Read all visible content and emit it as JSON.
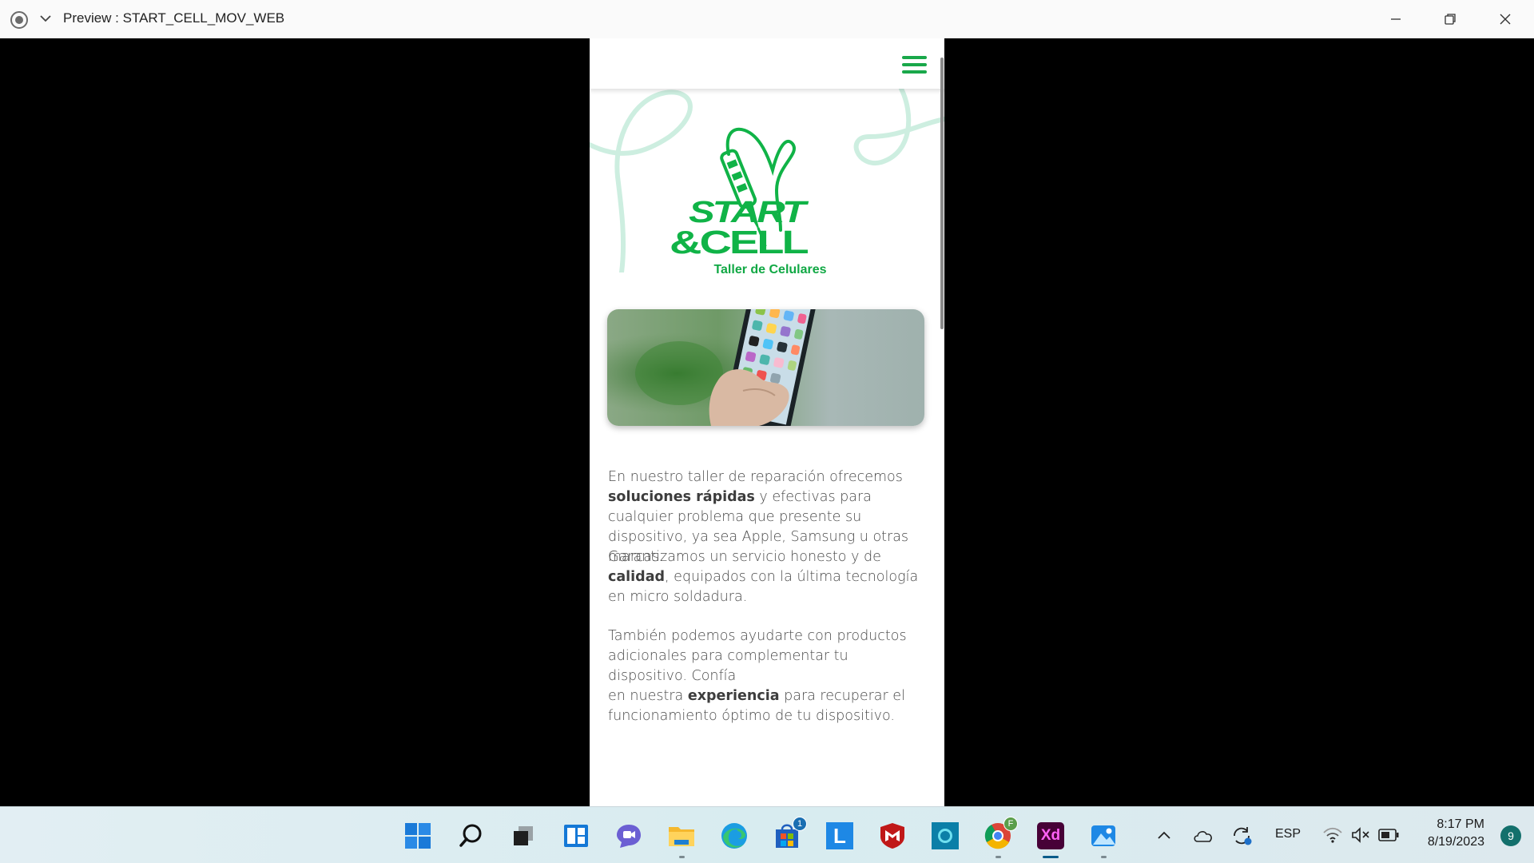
{
  "window": {
    "title": "Preview : START_CELL_MOV_WEB"
  },
  "phone": {
    "logo": {
      "line1": "START",
      "line2": "&CELL",
      "subtitle": "Taller de Celulares"
    },
    "paragraphs": [
      {
        "parts": [
          {
            "text": "En nuestro taller de reparación ofrecemos ",
            "bold": false
          },
          {
            "text": "soluciones rápidas",
            "bold": true
          },
          {
            "text": " y efectivas para cualquier problema que presente su dispositivo, ya sea Apple, Samsung u otras marcas.",
            "bold": false
          }
        ]
      },
      {
        "parts": [
          {
            "text": "Garantizamos un servicio honesto y de ",
            "bold": false
          },
          {
            "text": "calidad",
            "bold": true
          },
          {
            "text": ", equipados con la última tecnología en micro soldadura.",
            "bold": false
          }
        ]
      },
      {
        "parts": [
          {
            "text": "También podemos ayudarte con productos adicionales para complementar tu dispositivo. Confía",
            "bold": false
          },
          {
            "text": "\n",
            "bold": false
          },
          {
            "text": "en nuestra ",
            "bold": false
          },
          {
            "text": "experiencia",
            "bold": true
          },
          {
            "text": " para recuperar el funcionamiento óptimo de tu dispositivo.",
            "bold": false
          }
        ]
      }
    ],
    "accent_color": "#10b347"
  },
  "taskbar": {
    "apps": [
      {
        "name": "start-icon"
      },
      {
        "name": "search-icon"
      },
      {
        "name": "task-view-icon"
      },
      {
        "name": "widgets-icon"
      },
      {
        "name": "teams-chat-icon"
      },
      {
        "name": "file-explorer-icon"
      },
      {
        "name": "edge-icon"
      },
      {
        "name": "microsoft-store-icon",
        "badge": "1"
      },
      {
        "name": "app-l-icon",
        "letter": "L"
      },
      {
        "name": "mcafee-icon"
      },
      {
        "name": "cortana-icon"
      },
      {
        "name": "chrome-icon",
        "badge": "F"
      },
      {
        "name": "adobe-xd-icon",
        "letter": "Xd"
      },
      {
        "name": "photos-icon"
      }
    ],
    "language": "ESP",
    "time": "8:17 PM",
    "date": "8/19/2023",
    "notifications": "9"
  }
}
